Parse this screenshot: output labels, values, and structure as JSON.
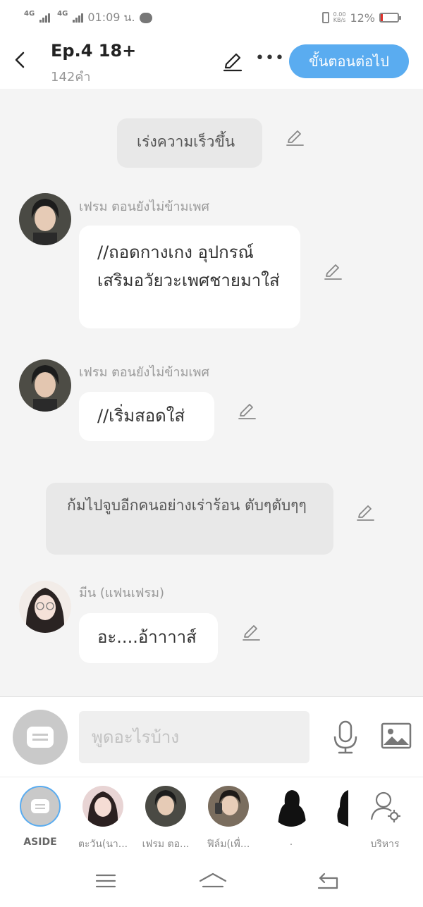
{
  "status_bar": {
    "net1": "4G",
    "net2": "4G",
    "time": "01:09 น.",
    "speed_value": "0.00",
    "speed_unit": "KB/s",
    "battery_percent": "12%",
    "battery_level": 0.12
  },
  "header": {
    "title": "Ep.4 18+",
    "word_count": "142คำ",
    "more_label": "•••",
    "next_label": "ขั้นตอนต่อไป"
  },
  "messages": [
    {
      "type": "narration",
      "text": "เร่งความเร็วขึ้น"
    },
    {
      "type": "bubble",
      "speaker": "เฟรม ตอนยังไม่ข้ามเพศ",
      "text": "//ถอดกางเกง อุปกรณ์เสริมอวัยวะเพศชายมาใส่"
    },
    {
      "type": "bubble",
      "speaker": "เฟรม ตอนยังไม่ข้ามเพศ",
      "text": "//เริ่มสอดใส่"
    },
    {
      "type": "narration",
      "text": "ก้มไปจูบอีกคนอย่างเร่าร้อน ตับๆตับๆๆ"
    },
    {
      "type": "bubble",
      "speaker": "มีน (แฟนเฟรม)",
      "text": "อะ....อ้าาาาส์"
    }
  ],
  "input": {
    "placeholder": "พูดอะไรบ้าง"
  },
  "characters": [
    {
      "name": "ASIDE"
    },
    {
      "name": "ตะวัน(นา..."
    },
    {
      "name": "เฟรม ตอ..."
    },
    {
      "name": "ฟิล์ม(เพื่..."
    },
    {
      "name": "."
    },
    {
      "name": "บริหาร"
    }
  ],
  "colors": {
    "accent": "#5aacf0",
    "background": "#f4f4f4",
    "narration_bg": "#e8e8e8"
  }
}
